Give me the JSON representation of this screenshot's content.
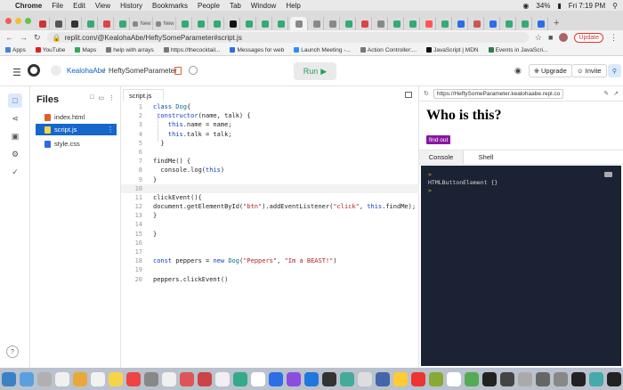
{
  "menubar": {
    "apple": "",
    "items": [
      "Chrome",
      "File",
      "Edit",
      "View",
      "History",
      "Bookmarks",
      "People",
      "Tab",
      "Window",
      "Help"
    ],
    "battery": "34%",
    "clock": "Fri 7:19 PM"
  },
  "browser": {
    "tabs": [
      "",
      "",
      "",
      "",
      "",
      "",
      "New",
      "New",
      "",
      "",
      "",
      "",
      "",
      "",
      "",
      "",
      "",
      "",
      "",
      "",
      "",
      "",
      "",
      "",
      "",
      "",
      "",
      "",
      "",
      "",
      ""
    ],
    "active_tab_index": 15,
    "new_tab_glyph": "+",
    "url": "replit.com/@KealohaAbe/HeftySomeParameter#script.js",
    "update_label": "Update",
    "bookmarks": [
      "Apps",
      "YouTube",
      "Maps",
      "help with arrays",
      "https://thecocktail...",
      "Messages for web",
      "Launch Meeting -...",
      "Action Controller:...",
      "JavaScript | MDN",
      "Events in JavaScri..."
    ]
  },
  "replit": {
    "user": "KealohaAbe",
    "separator": "/",
    "repl_name": "HeftySomeParameter",
    "run_label": "Run",
    "upgrade_label": "Upgrade",
    "invite_label": "Invite",
    "files_header": "Files",
    "files": [
      {
        "name": "index.html",
        "type": "html",
        "selected": false
      },
      {
        "name": "script.js",
        "type": "js",
        "selected": true
      },
      {
        "name": "style.css",
        "type": "css",
        "selected": false
      }
    ],
    "editor_tab": "script.js",
    "code_lines": [
      "class Dog{",
      " constructor(name, talk) {",
      "    this.name = name;",
      "    this.talk = talk;",
      "  }",
      "",
      "findMe() {",
      "  console.log(this)",
      "}",
      "",
      "clickEvent(){",
      "document.getElementById(\"btn\").addEventListener(\"click\", this.findMe);",
      "}",
      "",
      "}",
      "",
      "",
      "const peppers = new Dog(\"Peppers\", \"Im a BEAST!\")",
      "",
      "peppers.clickEvent()"
    ],
    "current_line": 10,
    "webview_url": "https://HeftySomeParameter.kealohaabe.repl.co",
    "page_heading": "Who is this?",
    "page_button": "find out",
    "console_tabs": [
      "Console",
      "Shell"
    ],
    "console_output": [
      "HTMLButtonElement {}"
    ],
    "prompt_glyph": ">",
    "help_glyph": "?"
  },
  "colors": {
    "accent": "#1567cb",
    "run_green": "#2a9e58",
    "button_purple": "#8a16a0",
    "console_bg": "#1a2233"
  }
}
